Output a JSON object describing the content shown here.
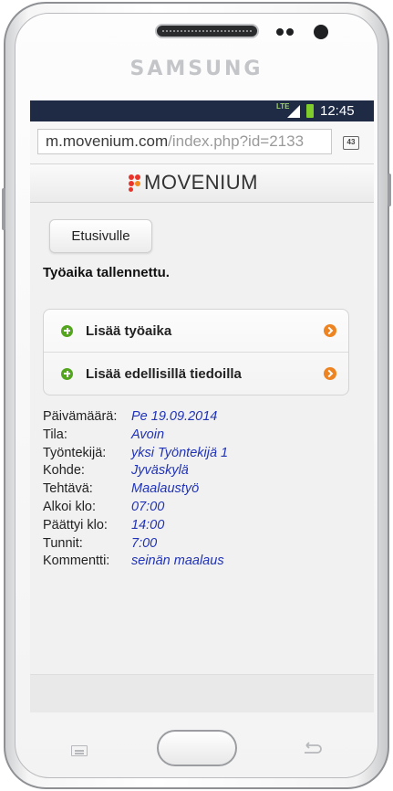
{
  "device": {
    "brand": "SAMSUNG"
  },
  "status_bar": {
    "network": "LTE",
    "time": "12:45"
  },
  "browser": {
    "url_host": "m.movenium.com",
    "url_path": "/index.php?id=2133",
    "tab_count": "43"
  },
  "app": {
    "logo_text": "MOVENIUM",
    "home_button": "Etusivulle",
    "saved_message": "Työaika tallennettu.",
    "actions": [
      {
        "label": "Lisää työaika"
      },
      {
        "label": "Lisää edellisillä tiedoilla"
      }
    ],
    "details": [
      {
        "label": "Päivämäärä:",
        "value": "Pe 19.09.2014"
      },
      {
        "label": "Tila:",
        "value": "Avoin"
      },
      {
        "label": "Työntekijä:",
        "value": "yksi Työntekijä 1"
      },
      {
        "label": "Kohde:",
        "value": "Jyväskylä"
      },
      {
        "label": "Tehtävä:",
        "value": "Maalaustyö"
      },
      {
        "label": "Alkoi klo:",
        "value": "07:00"
      },
      {
        "label": "Päättyi klo:",
        "value": "14:00"
      },
      {
        "label": "Tunnit:",
        "value": "7:00"
      },
      {
        "label": "Kommentti:",
        "value": "seinän maalaus"
      }
    ]
  },
  "colors": {
    "value_text": "#2033b8",
    "plus_icon": "#52a51c",
    "arrow_icon": "#ee8421",
    "status_bar": "#1f2a44"
  }
}
